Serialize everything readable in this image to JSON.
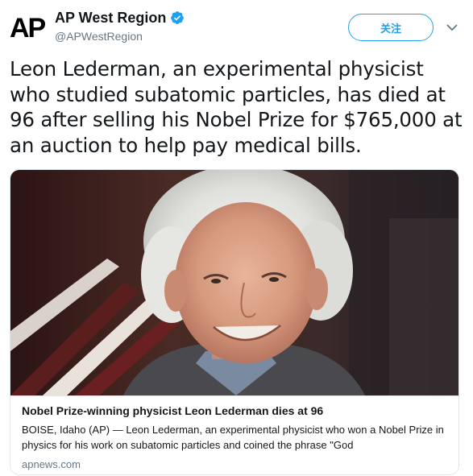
{
  "author": {
    "logo_text": "AP",
    "display_name": "AP West Region",
    "handle": "@APWestRegion",
    "verified": true
  },
  "actions": {
    "follow_label": "关注",
    "menu_icon": "chevron-down-icon"
  },
  "tweet": {
    "text": "Leon Lederman, an experimental physicist who studied subatomic particles, has died at 96 after selling his Nobel Prize for $765,000 at an auction to help pay medical bills."
  },
  "card": {
    "image_icon": "portrait-photo",
    "title": "Nobel Prize-winning physicist Leon Lederman dies at 96",
    "description": "BOISE, Idaho (AP) — Leon Lederman, an experimental physicist who won a Nobel Prize in physics for his work on subatomic particles and coined the phrase \"God",
    "domain": "apnews.com"
  },
  "colors": {
    "accent": "#1da1f2",
    "text": "#14171a",
    "muted": "#657786",
    "border": "#e1e8ed"
  }
}
